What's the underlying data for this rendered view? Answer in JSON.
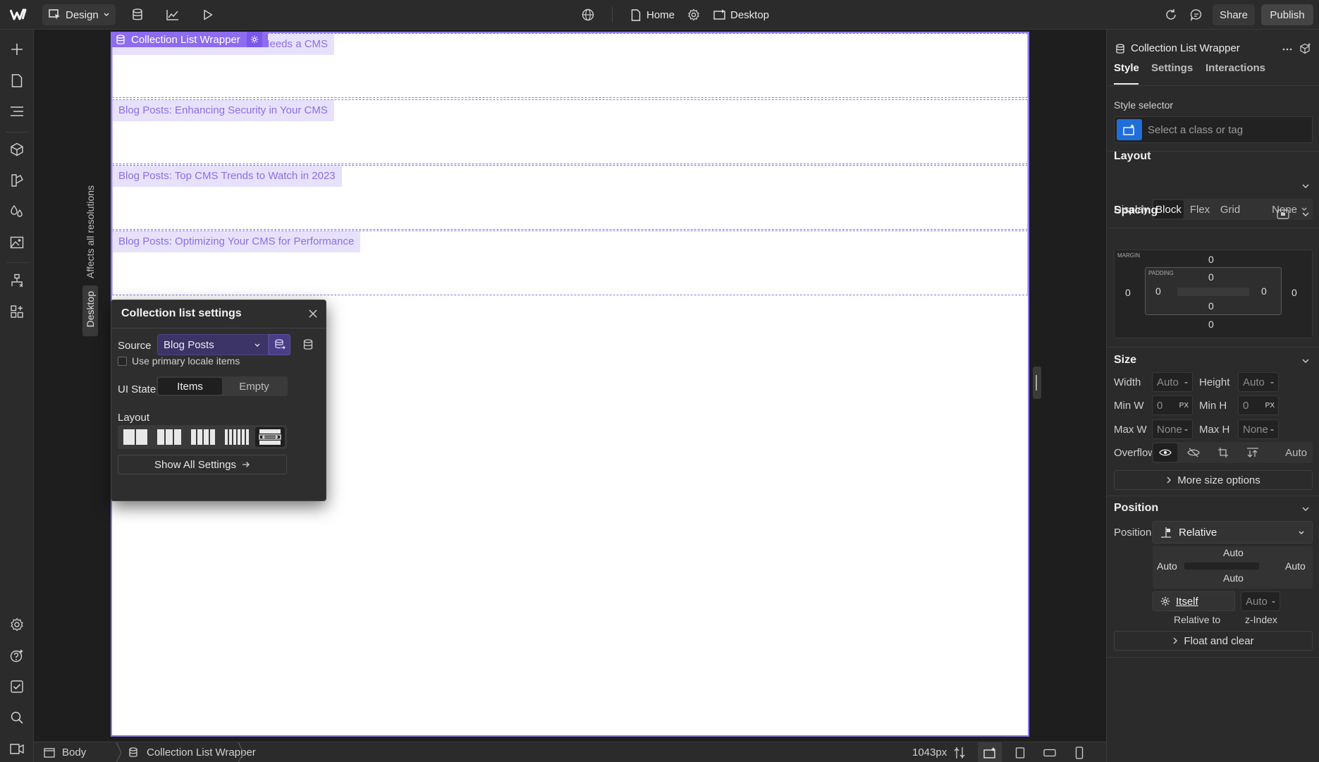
{
  "topbar": {
    "mode_label": "Design",
    "page_label": "Home",
    "breakpoint_label": "Desktop",
    "share_label": "Share",
    "publish_label": "Publish"
  },
  "canvas": {
    "selected_tag": "Collection List Wrapper",
    "items": [
      {
        "label": "Blog Posts: Why Your Business Needs a CMS",
        "visible_label": "s Needs a CMS"
      },
      {
        "label": "Blog Posts: Enhancing Security in Your CMS"
      },
      {
        "label": "Blog Posts: Top CMS Trends to Watch in 2023"
      },
      {
        "label": "Blog Posts: Optimizing Your CMS for Performance"
      }
    ],
    "side_labels": {
      "affects": "Affects all resolutions",
      "desktop": "Desktop"
    }
  },
  "popup": {
    "title": "Collection list settings",
    "source_label": "Source",
    "source_value": "Blog Posts",
    "primary_locale_label": "Use primary locale items",
    "ui_state_label": "UI State",
    "ui_state_options": [
      "Items",
      "Empty"
    ],
    "ui_state_selected": "Items",
    "layout_label": "Layout",
    "show_all_label": "Show All Settings"
  },
  "rpanel": {
    "header_title": "Collection List Wrapper",
    "tabs": [
      "Style",
      "Settings",
      "Interactions"
    ],
    "active_tab": "Style",
    "style_selector_label": "Style selector",
    "style_selector_placeholder": "Select a class or tag",
    "layout": {
      "title": "Layout",
      "display_label": "Display",
      "display_options": [
        "Block",
        "Flex",
        "Grid",
        "None"
      ],
      "display_selected": "Block"
    },
    "spacing": {
      "title": "Spacing",
      "margin_label": "MARGIN",
      "padding_label": "PADDING",
      "margin": {
        "top": "0",
        "right": "0",
        "bottom": "0",
        "left": "0"
      },
      "padding": {
        "top": "0",
        "right": "0",
        "bottom": "0",
        "left": "0"
      }
    },
    "size": {
      "title": "Size",
      "width_label": "Width",
      "width_value": "Auto",
      "height_label": "Height",
      "height_value": "Auto",
      "minw_label": "Min W",
      "minw_value": "0",
      "minw_unit": "PX",
      "minh_label": "Min H",
      "minh_value": "0",
      "minh_unit": "PX",
      "maxw_label": "Max W",
      "maxw_value": "None",
      "maxh_label": "Max H",
      "maxh_value": "None",
      "dash": "-",
      "overflow_label": "Overflow",
      "overflow_auto": "Auto",
      "more_label": "More size options"
    },
    "position": {
      "title": "Position",
      "position_label": "Position",
      "position_value": "Relative",
      "offsets": {
        "top": "Auto",
        "left": "Auto",
        "right": "Auto",
        "bottom": "Auto"
      },
      "itself_label": "Itself",
      "z_value": "Auto",
      "dash": "-",
      "relative_to_label": "Relative to",
      "zindex_label": "z-Index",
      "float_label": "Float and clear"
    }
  },
  "bottombar": {
    "crumbs": [
      "Body",
      "Collection List Wrapper"
    ],
    "width_readout": "1043px"
  }
}
